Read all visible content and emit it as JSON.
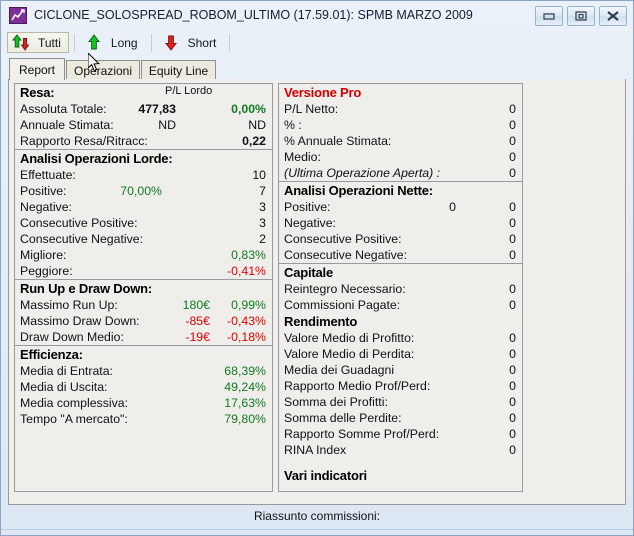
{
  "window": {
    "title": "CICLONE_SOLOSPREAD_ROBOM_ULTIMO (17.59.01): SPMB MARZO 2009",
    "icon": "chart-app-icon",
    "buttons": [
      {
        "name": "minimize-button",
        "label": "–"
      },
      {
        "name": "restore-button",
        "label": "❐"
      },
      {
        "name": "close-button",
        "label": "✕"
      }
    ]
  },
  "toolbar": {
    "buttons": [
      {
        "label": "Tutti",
        "icon": "up-down-arrows-icon",
        "active": true
      },
      {
        "label": "Long",
        "icon": "green-up-arrow-icon",
        "active": false
      },
      {
        "label": "Short",
        "icon": "red-down-arrow-icon",
        "active": false
      }
    ]
  },
  "tabs": [
    {
      "label": "Report",
      "selected": true
    },
    {
      "label": "Operazioni",
      "selected": false
    },
    {
      "label": "Equity Line",
      "selected": false
    }
  ],
  "left_panel": {
    "resa": {
      "heading": "Resa:",
      "column_header": "P/L Lordo",
      "rows": [
        {
          "label": "Assoluta Totale:",
          "mid": "477,83",
          "value": "0,00%",
          "mid_style": "bold",
          "value_style": "green-bold"
        },
        {
          "label": "Annuale Stimata:",
          "mid": "ND",
          "value": "ND",
          "mid_style": "plain",
          "value_style": "plain"
        },
        {
          "label": "Rapporto Resa/Ritracc:",
          "mid": "",
          "value": "0,22",
          "mid_style": "plain",
          "value_style": "bold"
        }
      ]
    },
    "analisi_lorde": {
      "heading": "Analisi Operazioni Lorde:",
      "rows": [
        {
          "label": "Effettuate:",
          "mid": "",
          "value": "10",
          "mid_style": "plain",
          "value_style": "plain"
        },
        {
          "label": "Positive:",
          "mid": "70,00%",
          "value": "7",
          "mid_style": "green",
          "value_style": "plain"
        },
        {
          "label": "Negative:",
          "mid": "",
          "value": "3",
          "mid_style": "plain",
          "value_style": "plain"
        },
        {
          "label": "Consecutive Positive:",
          "mid": "",
          "value": "3",
          "mid_style": "plain",
          "value_style": "plain"
        },
        {
          "label": "Consecutive Negative:",
          "mid": "",
          "value": "2",
          "mid_style": "plain",
          "value_style": "plain"
        },
        {
          "label": "Migliore:",
          "mid": "",
          "value": "0,83%",
          "mid_style": "plain",
          "value_style": "green"
        },
        {
          "label": "Peggiore:",
          "mid": "",
          "value": "-0,41%",
          "mid_style": "plain",
          "value_style": "red"
        }
      ]
    },
    "runup_drawdown": {
      "heading": "Run Up e Draw Down:",
      "rows": [
        {
          "label": "Massimo Run Up:",
          "mid": "180€",
          "value": "0,99%",
          "mid_style": "green",
          "value_style": "green"
        },
        {
          "label": "Massimo Draw Down:",
          "mid": "-85€",
          "value": "-0,43%",
          "mid_style": "red",
          "value_style": "red"
        },
        {
          "label": "Draw Down Medio:",
          "mid": "-19€",
          "value": "-0,18%",
          "mid_style": "red",
          "value_style": "red"
        }
      ]
    },
    "efficienza": {
      "heading": "Efficienza:",
      "rows": [
        {
          "label": "Media di Entrata:",
          "mid": "",
          "value": "68,39%",
          "mid_style": "plain",
          "value_style": "green"
        },
        {
          "label": "Media di Uscita:",
          "mid": "",
          "value": "49,24%",
          "mid_style": "plain",
          "value_style": "green"
        },
        {
          "label": "Media complessiva:",
          "mid": "",
          "value": "17,63%",
          "mid_style": "plain",
          "value_style": "green"
        },
        {
          "label": "Tempo \"A mercato\":",
          "mid": "",
          "value": "79,80%",
          "mid_style": "plain",
          "value_style": "green"
        }
      ]
    }
  },
  "right_panel": {
    "versione_pro": {
      "heading": "Versione Pro",
      "rows": [
        {
          "label": "P/L Netto:",
          "mid": "",
          "value": "0",
          "italic": false
        },
        {
          "label": "% :",
          "mid": "",
          "value": "0",
          "italic": false
        },
        {
          "label": "% Annuale Stimata:",
          "mid": "",
          "value": "0",
          "italic": false
        },
        {
          "label": "Medio:",
          "mid": "",
          "value": "0",
          "italic": false
        },
        {
          "label": "(Ultima Operazione Aperta) :",
          "mid": "",
          "value": "0",
          "italic": true
        }
      ]
    },
    "analisi_nette": {
      "heading": "Analisi Operazioni Nette:",
      "rows": [
        {
          "label": "Positive:",
          "mid": "0",
          "value": "0",
          "italic": false
        },
        {
          "label": "Negative:",
          "mid": "",
          "value": "0",
          "italic": false
        },
        {
          "label": "Consecutive Positive:",
          "mid": "",
          "value": "0",
          "italic": false
        },
        {
          "label": "Consecutive Negative:",
          "mid": "",
          "value": "0",
          "italic": false
        }
      ]
    },
    "capitale": {
      "heading": "Capitale",
      "rows": [
        {
          "label": "Reintegro Necessario:",
          "mid": "",
          "value": "0",
          "italic": false
        },
        {
          "label": "Commissioni Pagate:",
          "mid": "",
          "value": "0",
          "italic": false
        }
      ]
    },
    "rendimento": {
      "heading": "Rendimento",
      "rows": [
        {
          "label": "Valore Medio di Profitto:",
          "mid": "",
          "value": "0",
          "italic": false
        },
        {
          "label": "Valore Medio di Perdita:",
          "mid": "",
          "value": "0",
          "italic": false
        },
        {
          "label": "Media dei Guadagni",
          "mid": "",
          "value": "0",
          "italic": false
        },
        {
          "label": "Rapporto Medio Prof/Perd:",
          "mid": "",
          "value": "0",
          "italic": false
        },
        {
          "label": "Somma dei Profitti:",
          "mid": "",
          "value": "0",
          "italic": false
        },
        {
          "label": "Somma delle Perdite:",
          "mid": "",
          "value": "0",
          "italic": false
        },
        {
          "label": "Rapporto Somme Prof/Perd:",
          "mid": "",
          "value": "0",
          "italic": false
        },
        {
          "label": "RINA Index",
          "mid": "",
          "value": "0",
          "italic": false
        }
      ]
    },
    "vari_indicatori": {
      "heading": "Vari indicatori",
      "rows": []
    }
  },
  "status": {
    "text": "Riassunto commissioni:"
  },
  "colors": {
    "positive": "#127a22",
    "negative": "#e00000",
    "pro_heading": "#d00000",
    "panel_bg": "#efeeea"
  }
}
